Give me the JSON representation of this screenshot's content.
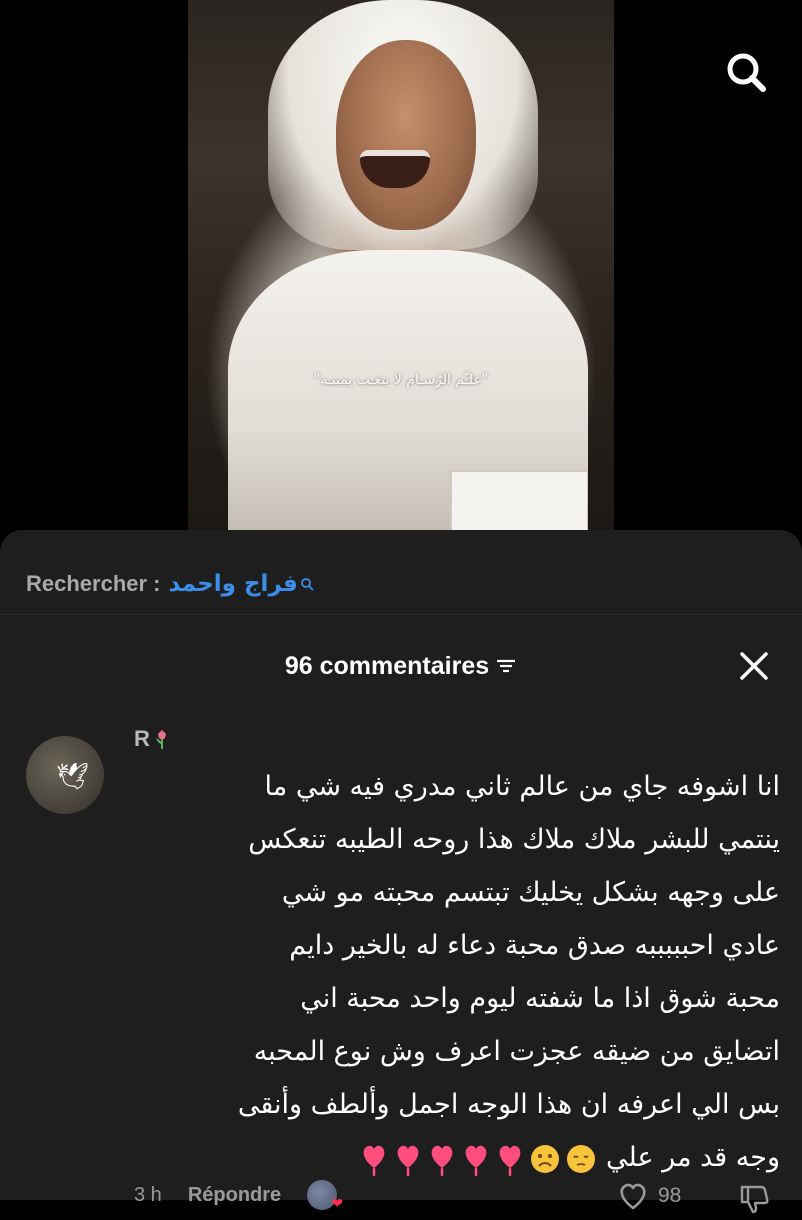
{
  "video": {
    "caption": "\"علـّم الرّسـام لا يتعـب يمينـه\""
  },
  "search": {
    "label": "Rechercher :",
    "query": "فراج واحمد"
  },
  "comments_header": {
    "count_label": "96 commentaires"
  },
  "comment": {
    "username": "R",
    "lines": [
      "انا اشوفه جاي من عالم ثاني مدري فيه شي ما",
      "ينتمي للبشر ملاك ملاك هذا روحه الطيبه تنعكس",
      "على وجهه بشكل يخليك تبتسم محبته مو شي",
      "عادي احبببببه صدق محبة دعاء له بالخير دايم",
      "محبة شوق اذا ما شفته ليوم واحد محبة اني",
      "اتضايق من ضيقه عجزت اعرف وش نوع المحبه",
      "بس الي اعرفه ان هذا الوجه اجمل وألطف وأنقى",
      "وجه قد مر علي"
    ],
    "time": "3 h",
    "reply_label": "Répondre",
    "likes": "98"
  },
  "icons": {
    "search": "search-icon",
    "filter": "filter-icon",
    "close": "close-icon",
    "heart": "heart-outline-icon",
    "dislike": "thumbs-down-icon"
  },
  "colors": {
    "accent": "#3b8ee9",
    "sheet_bg": "#1e1e1e",
    "heart_emoji": "#ff4d7d"
  }
}
